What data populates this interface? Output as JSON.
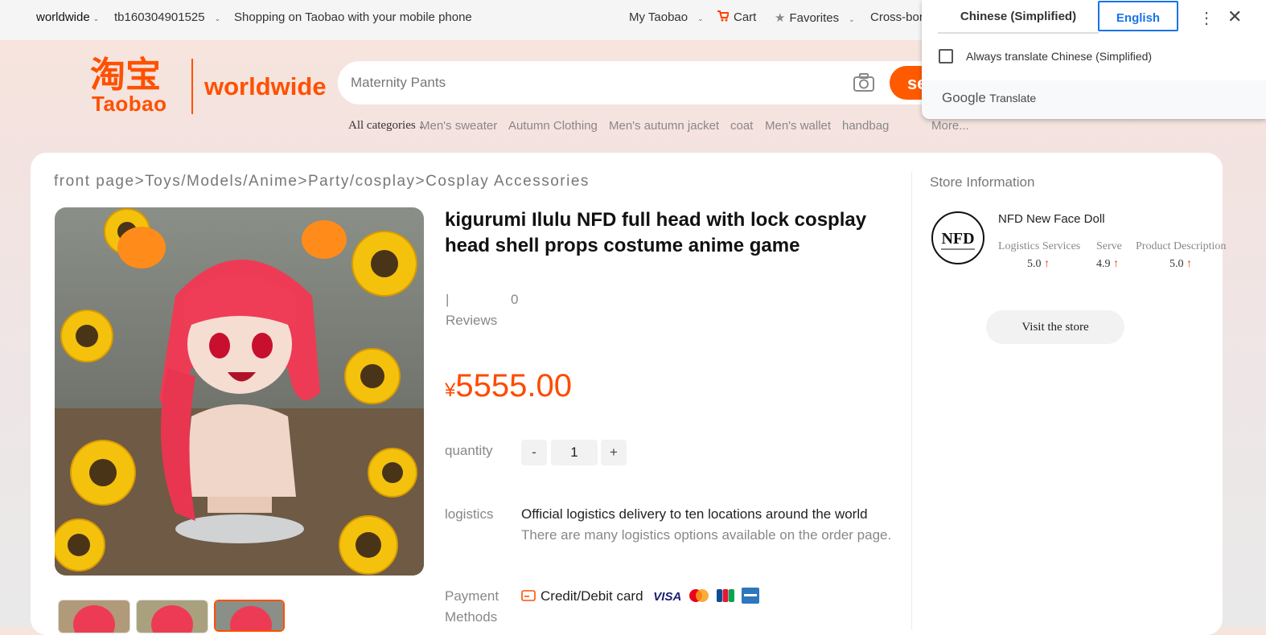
{
  "topbar": {
    "region": "worldwide",
    "account": "tb160304901525",
    "mobile_link": "Shopping on Taobao with your mobile phone",
    "my_taobao": "My Taobao",
    "cart": "Cart",
    "favorites": "Favorites",
    "cross_border": "Cross-bor"
  },
  "header": {
    "logo_cn": "淘宝",
    "logo_en": "Taobao",
    "logo_worldwide": "worldwide",
    "search_placeholder": "Maternity Pants",
    "search_button": "sea",
    "all_categories": "All categories",
    "categories": [
      "Men's sweater",
      "Autumn Clothing",
      "Men's autumn jacket",
      "coat",
      "Men's wallet",
      "handbag",
      "More..."
    ]
  },
  "breadcrumb": "front page>Toys/Models/Anime>Party/cosplay>Cosplay Accessories",
  "product": {
    "title": "kigurumi Ilulu NFD full head with lock cosplay head shell props costume anime game",
    "reviews_sep": "|",
    "reviews_count": "0",
    "reviews_label": "Reviews",
    "currency": "¥",
    "price": "5555.00",
    "quantity_label": "quantity",
    "qty_minus": "-",
    "qty_value": "1",
    "qty_plus": "+",
    "logistics_label": "logistics",
    "logistics_line1": "Official logistics delivery to ten locations around the world",
    "logistics_line2": "There are many logistics options available on the order page.",
    "payment_label": "Payment Methods",
    "payment_text": "Credit/Debit card",
    "card_brands": [
      "VISA",
      "mastercard",
      "JCB",
      "AMEX"
    ]
  },
  "store": {
    "heading": "Store Information",
    "logo_text": "NFD",
    "name": "NFD New Face Doll",
    "metrics": [
      {
        "label": "Logistics Services",
        "value": "5.0"
      },
      {
        "label": "Serve",
        "value": "4.9"
      },
      {
        "label": "Product Description",
        "value": "5.0"
      }
    ],
    "visit_button": "Visit the store"
  },
  "translate": {
    "tab_source": "Chinese (Simplified)",
    "tab_target": "English",
    "always_translate": "Always translate Chinese (Simplified)",
    "brand_google": "Google",
    "brand_translate": "Translate"
  },
  "colors": {
    "accent": "#ff5000",
    "price": "#ff4a00",
    "translate_blue": "#1a73e8"
  }
}
